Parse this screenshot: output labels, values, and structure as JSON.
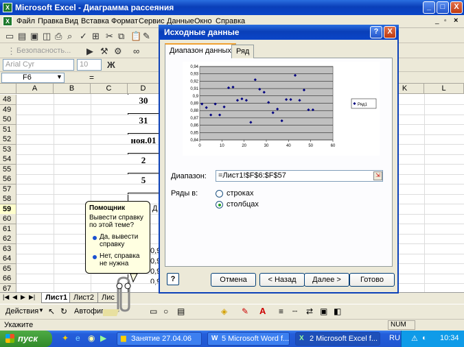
{
  "window": {
    "title": "Microsoft Excel - Диаграмма рассеяния",
    "minimize": "_",
    "maximize": "□",
    "close": "X"
  },
  "menu": [
    "Файл",
    "Правка",
    "Вид",
    "Вставка",
    "Формат",
    "Сервис",
    "Данные",
    "Окно",
    "Справка"
  ],
  "toolbar": {
    "security_label": "Безопасность...",
    "font_name": "Arial Cyr",
    "font_size": "10"
  },
  "formula_bar": {
    "name_box": "F6",
    "equals": "="
  },
  "grid": {
    "columns": [
      "A",
      "B",
      "C",
      "D",
      "K",
      "L"
    ],
    "rows": [
      "48",
      "49",
      "50",
      "51",
      "52",
      "53",
      "54",
      "55",
      "56",
      "57",
      "58",
      "59",
      "60",
      "61",
      "62",
      "63",
      "64",
      "65",
      "66",
      "67"
    ],
    "d_values": [
      "30",
      "31",
      "ноя.01",
      "2",
      "5"
    ],
    "partial_values": [
      "Д",
      "0,9",
      "0,9",
      "0,9",
      "0,9"
    ]
  },
  "sheet_tabs": [
    "Лист1",
    "Лист2",
    "Лис"
  ],
  "drawing": {
    "actions_label": "Действия",
    "autoshapes_label": "Автофигуры"
  },
  "status": {
    "left": "Укажите",
    "num": "NUM"
  },
  "taskbar": {
    "start_label": "пуск",
    "items": [
      "Занятие 27.04.06",
      "5 Microsoft Word f...",
      "2 Microsoft Excel f..."
    ],
    "language": "RU",
    "clock": "10:34"
  },
  "dialog": {
    "title": "Исходные данные",
    "help_button": "?",
    "close_button": "X",
    "tabs": [
      "Диапазон данных",
      "Ряд"
    ],
    "range_label": "Диапазон:",
    "range_value": "=Лист1!$F$6:$F$57",
    "series_in_label": "Ряды в:",
    "options": [
      "строках",
      "столбцах"
    ],
    "selected_option": "столбцах",
    "buttons": {
      "cancel": "Отмена",
      "back": "< Назад",
      "next": "Далее >",
      "finish": "Готово"
    }
  },
  "assistant": {
    "header": "Помощник",
    "question": "Вывести справку по этой теме?",
    "option_yes": "Да, вывести справку",
    "option_no": "Нет, справка не нужна"
  },
  "chart_data": {
    "type": "scatter",
    "title": "",
    "xlabel": "",
    "ylabel": "",
    "xlim": [
      0,
      60
    ],
    "ylim": [
      0.84,
      0.94
    ],
    "x_ticks": [
      "0",
      "10",
      "20",
      "30",
      "40",
      "50",
      "60"
    ],
    "y_ticks": [
      "0,84",
      "0,85",
      "0,86",
      "0,87",
      "0,88",
      "0,89",
      "0,9",
      "0,91",
      "0,92",
      "0,93",
      "0,94"
    ],
    "legend": "right",
    "grid": true,
    "series": [
      {
        "name": "Ряд1",
        "color": "#000080",
        "points": [
          [
            1,
            0.889
          ],
          [
            3,
            0.884
          ],
          [
            5,
            0.874
          ],
          [
            7,
            0.889
          ],
          [
            9,
            0.874
          ],
          [
            11,
            0.885
          ],
          [
            13,
            0.911
          ],
          [
            15,
            0.912
          ],
          [
            17,
            0.894
          ],
          [
            19,
            0.896
          ],
          [
            21,
            0.894
          ],
          [
            23,
            0.864
          ],
          [
            25,
            0.922
          ],
          [
            27,
            0.909
          ],
          [
            29,
            0.905
          ],
          [
            31,
            0.891
          ],
          [
            33,
            0.877
          ],
          [
            35,
            0.882
          ],
          [
            37,
            0.866
          ],
          [
            39,
            0.895
          ],
          [
            41,
            0.895
          ],
          [
            43,
            0.928
          ],
          [
            45,
            0.894
          ],
          [
            47,
            0.908
          ],
          [
            49,
            0.881
          ],
          [
            51,
            0.881
          ]
        ]
      }
    ]
  }
}
